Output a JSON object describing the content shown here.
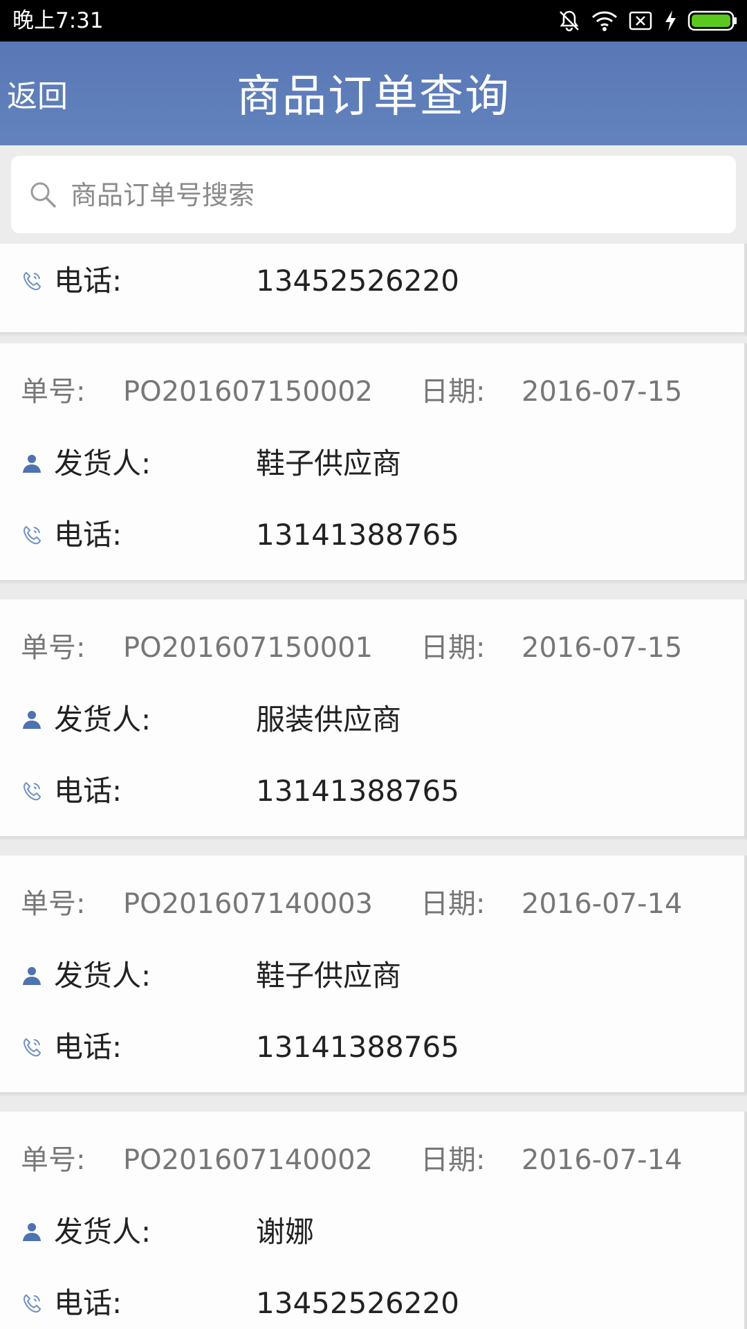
{
  "status_bar": {
    "time": "晚上7:31",
    "icons": [
      "mute-bell-icon",
      "wifi-icon",
      "sim-x-icon",
      "charging-bolt-icon",
      "battery-icon"
    ],
    "battery_color": "#5ac81e"
  },
  "nav": {
    "back_label": "返回",
    "title": "商品订单查询",
    "bg_color": "#5b7ab8"
  },
  "search": {
    "placeholder": "商品订单号搜索",
    "value": ""
  },
  "labels": {
    "order_no": "单号:",
    "date": "日期:",
    "shipper": "发货人:",
    "phone": "电话:"
  },
  "partial_order": {
    "phone": "13452526220"
  },
  "orders": [
    {
      "order_no": "PO201607150002",
      "date": "2016-07-15",
      "shipper": "鞋子供应商",
      "phone": "13141388765"
    },
    {
      "order_no": "PO201607150001",
      "date": "2016-07-15",
      "shipper": "服装供应商",
      "phone": "13141388765"
    },
    {
      "order_no": "PO201607140003",
      "date": "2016-07-14",
      "shipper": "鞋子供应商",
      "phone": "13141388765"
    },
    {
      "order_no": "PO201607140002",
      "date": "2016-07-14",
      "shipper": "谢娜",
      "phone": "13452526220"
    }
  ]
}
